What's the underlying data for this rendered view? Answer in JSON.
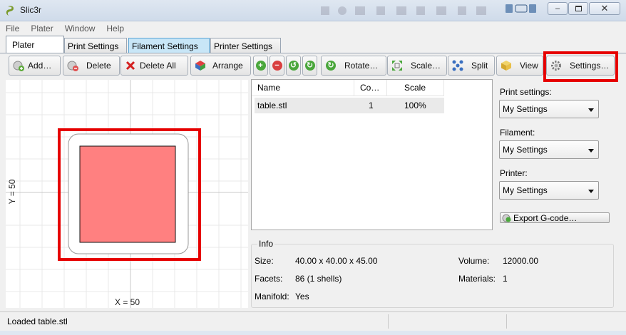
{
  "window": {
    "title": "Slic3r"
  },
  "menu": [
    "File",
    "Plater",
    "Window",
    "Help"
  ],
  "tabs": [
    {
      "label": "Plater",
      "active": true
    },
    {
      "label": "Print Settings"
    },
    {
      "label": "Filament Settings",
      "highlighted": true
    },
    {
      "label": "Printer Settings"
    }
  ],
  "toolbar": {
    "add": "Add…",
    "delete": "Delete",
    "delete_all": "Delete All",
    "arrange": "Arrange",
    "rotate": "Rotate…",
    "scale": "Scale…",
    "split": "Split",
    "view": "View",
    "settings": "Settings…"
  },
  "plater": {
    "y_label": "Y = 50",
    "x_label": "X = 50"
  },
  "object_list": {
    "columns": [
      "Name",
      "Co…",
      "Scale"
    ],
    "rows": [
      {
        "name": "table.stl",
        "copies": "1",
        "scale": "100%"
      }
    ]
  },
  "info": {
    "title": "Info",
    "size_label": "Size:",
    "size_value": "40.00 x 40.00 x 45.00",
    "volume_label": "Volume:",
    "volume_value": "12000.00",
    "facets_label": "Facets:",
    "facets_value": "86 (1 shells)",
    "materials_label": "Materials:",
    "materials_value": "1",
    "manifold_label": "Manifold:",
    "manifold_value": "Yes"
  },
  "right_panel": {
    "print_settings_label": "Print settings:",
    "print_settings_value": "My Settings",
    "filament_label": "Filament:",
    "filament_value": "My Settings",
    "printer_label": "Printer:",
    "printer_value": "My Settings",
    "export_label": "Export G-code…"
  },
  "status": "Loaded table.stl",
  "colors": {
    "object_fill": "#ff8080",
    "highlight": "#e60000",
    "tab_highlight": "#c8e6f7"
  }
}
